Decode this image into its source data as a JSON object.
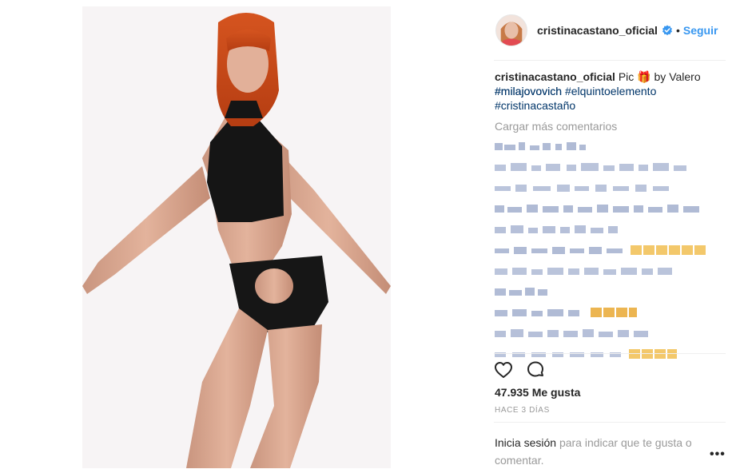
{
  "post": {
    "username": "cristinacastano_oficial",
    "dot": "•",
    "follow_label": "Seguir",
    "caption": {
      "username": "cristinacastano_oficial",
      "text_before": "Pic",
      "gift_emoji": "🎁",
      "text_after": "by Valero",
      "hashtags": [
        "#milajovovich",
        "#elquintoelemento",
        "#cristinacastaño"
      ]
    },
    "load_more_label": "Cargar más comentarios",
    "likes": "47.935 Me gusta",
    "timestamp": "HACE 3 DÍAS",
    "login_prompt": {
      "link": "Inicia sesión",
      "rest": "para indicar que te gusta o comentar."
    },
    "more_options": "•••"
  },
  "colors": {
    "link_blue": "#3897f0",
    "hashtag_blue": "#003569",
    "muted": "#999999",
    "text": "#262626"
  },
  "icons": {
    "verified": "verified-badge-icon",
    "like": "heart-outline-icon",
    "comment": "comment-bubble-icon",
    "more": "more-options-icon"
  }
}
